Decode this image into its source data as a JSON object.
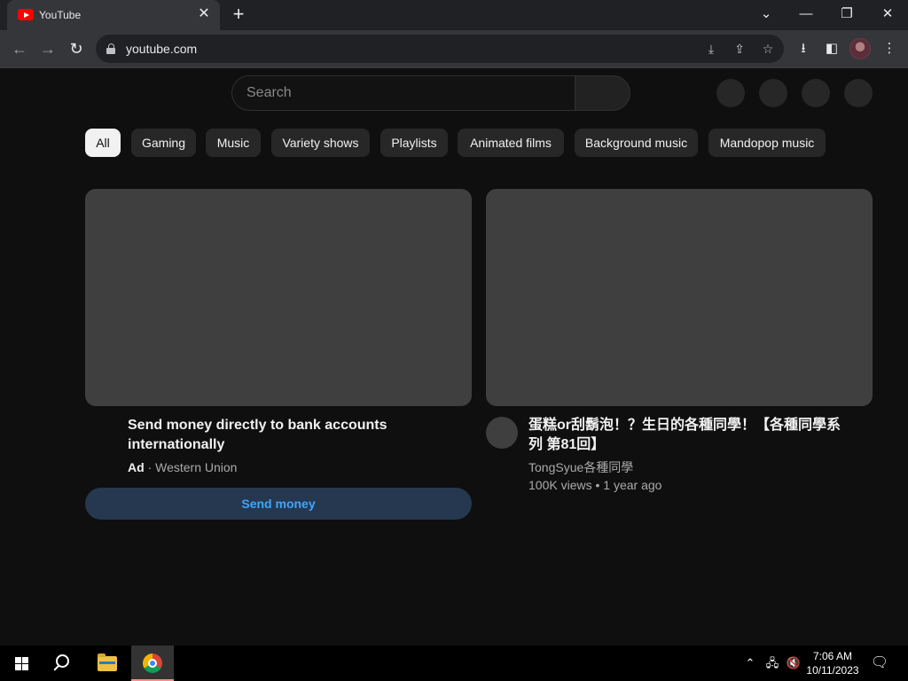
{
  "browser": {
    "tab_title": "YouTube",
    "url": "youtube.com",
    "icons": [
      "youtube-favicon",
      "close-icon",
      "plus-icon",
      "chevron-down-icon",
      "minimize-icon",
      "restore-icon",
      "window-close-icon",
      "back-icon",
      "forward-icon",
      "reload-icon",
      "lock-icon",
      "install-icon",
      "share-icon",
      "star-icon",
      "download-icon",
      "sidepanel-icon",
      "more-icon"
    ]
  },
  "youtube": {
    "search_placeholder": "Search",
    "chips": [
      "All",
      "Gaming",
      "Music",
      "Variety shows",
      "Playlists",
      "Animated films",
      "Background music",
      "Mandopop music"
    ],
    "videos": [
      {
        "title_line1": "Send money directly to bank accounts",
        "title_line2": "internationally",
        "ad_badge": "Ad",
        "sponsor": "Western Union",
        "cta": "Send money"
      },
      {
        "title_line1": "蛋糕or刮鬍泡！？生日的各種同學！【各種同學系",
        "title_line2": "列 第81回】",
        "channel": "TongSyue各種同學",
        "views": "100K views",
        "age": "1 year ago"
      }
    ]
  },
  "taskbar": {
    "time": "7:06 AM",
    "date": "10/11/2023",
    "accent_color": "#ff8c8c"
  }
}
